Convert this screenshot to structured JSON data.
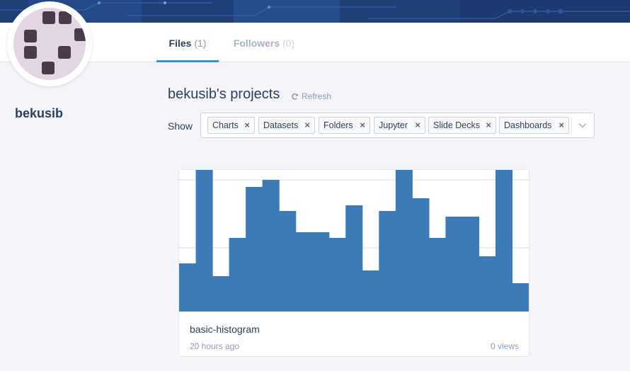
{
  "profile": {
    "username": "bekusib"
  },
  "tabs": [
    {
      "label": "Files",
      "count": "(1)",
      "active": true
    },
    {
      "label": "Followers",
      "count": "(0)",
      "active": false
    }
  ],
  "projects": {
    "title": "bekusib's projects",
    "refresh_label": "Refresh"
  },
  "filter": {
    "show_label": "Show",
    "chips": [
      "Charts",
      "Datasets",
      "Folders",
      "Jupyter",
      "Slide Decks",
      "Dashboards"
    ],
    "remove_glyph": "×"
  },
  "files": [
    {
      "name": "basic-histogram",
      "time": "20 hours ago",
      "views": "0 views"
    }
  ],
  "colors": {
    "accent": "#119dff",
    "text": "#2a3f5f",
    "muted": "#8c9bb5",
    "histogram": "#3d7ab8",
    "banner": "#1f3f78",
    "avatar_bg": "#e2d5e4",
    "avatar_fg": "#4a3a4b"
  },
  "chart_data": {
    "type": "bar",
    "title": "",
    "xlabel": "",
    "ylabel": "",
    "ylim": [
      0,
      1
    ],
    "values": [
      0.34,
      1.0,
      0.25,
      0.52,
      0.88,
      0.93,
      0.71,
      0.56,
      0.56,
      0.52,
      0.75,
      0.29,
      0.71,
      1.0,
      0.8,
      0.52,
      0.67,
      0.67,
      0.39,
      1.0,
      0.2
    ],
    "grid": true
  }
}
